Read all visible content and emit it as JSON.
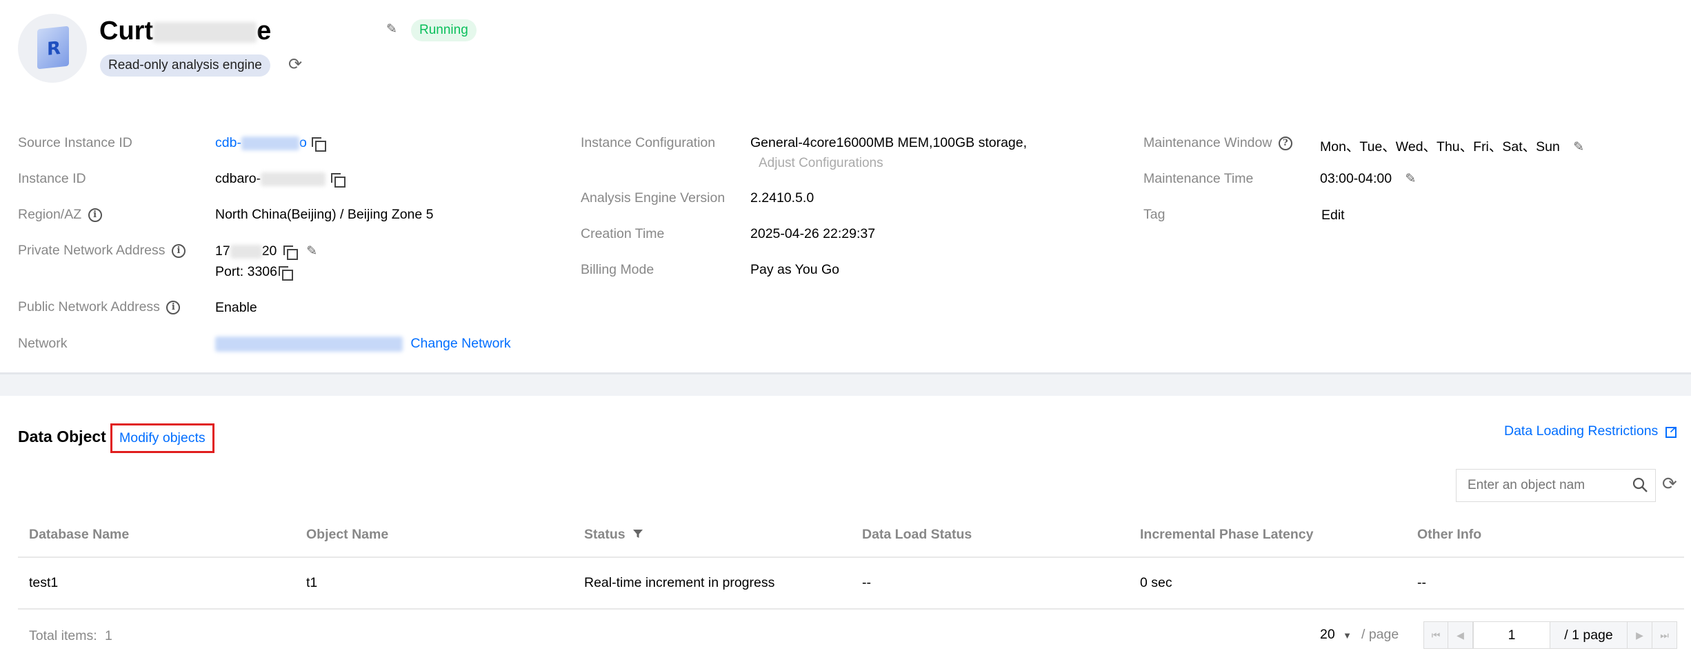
{
  "header": {
    "instance_name_prefix": "Curt",
    "instance_name_suffix": "e",
    "status": "Running",
    "engine_badge": "Read-only analysis engine"
  },
  "details": {
    "col1": {
      "source_instance_id_label": "Source Instance ID",
      "source_instance_id_prefix": "cdb-",
      "source_instance_id_suffix": "o",
      "instance_id_label": "Instance ID",
      "instance_id_prefix": "cdbaro-",
      "region_label": "Region/AZ",
      "region_value": "North China(Beijing) / Beijing Zone 5",
      "private_addr_label": "Private Network Address",
      "private_addr_prefix": "17",
      "private_addr_suffix": "20",
      "port": "Port: 3306",
      "public_addr_label": "Public Network Address",
      "public_addr_action": "Enable",
      "network_label": "Network",
      "change_network": "Change Network"
    },
    "col2": {
      "config_label": "Instance Configuration",
      "config_value": "General-4core16000MB MEM,100GB storage,",
      "adjust_config": "Adjust Configurations",
      "engine_version_label": "Analysis Engine Version",
      "engine_version_value": "2.2410.5.0",
      "creation_time_label": "Creation Time",
      "creation_time_value": "2025-04-26 22:29:37",
      "billing_label": "Billing Mode",
      "billing_value": "Pay as You Go"
    },
    "col3": {
      "maint_window_label": "Maintenance Window",
      "maint_window_value": "Mon、Tue、Wed、Thu、Fri、Sat、Sun",
      "maint_time_label": "Maintenance Time",
      "maint_time_value": "03:00-04:00",
      "tag_label": "Tag",
      "tag_action": "Edit"
    }
  },
  "data_object": {
    "title": "Data Object",
    "modify_button": "Modify objects",
    "restrictions_link": "Data Loading Restrictions",
    "search_placeholder": "Enter an object nam",
    "columns": [
      "Database Name",
      "Object Name",
      "Status",
      "Data Load Status",
      "Incremental Phase Latency",
      "Other Info"
    ],
    "rows": [
      [
        "test1",
        "t1",
        "Real-time increment in progress",
        "--",
        "0 sec",
        "--"
      ]
    ],
    "total_label": "Total items:",
    "total_value": "1",
    "page_size": "20",
    "page_size_suffix": "/ page",
    "current_page": "1",
    "total_pages": "/ 1 page"
  },
  "colors": {
    "link": "#006eff",
    "running_bg": "#e5f8ec",
    "running_text": "#0abf5b",
    "highlight_border": "#e01e1e"
  }
}
